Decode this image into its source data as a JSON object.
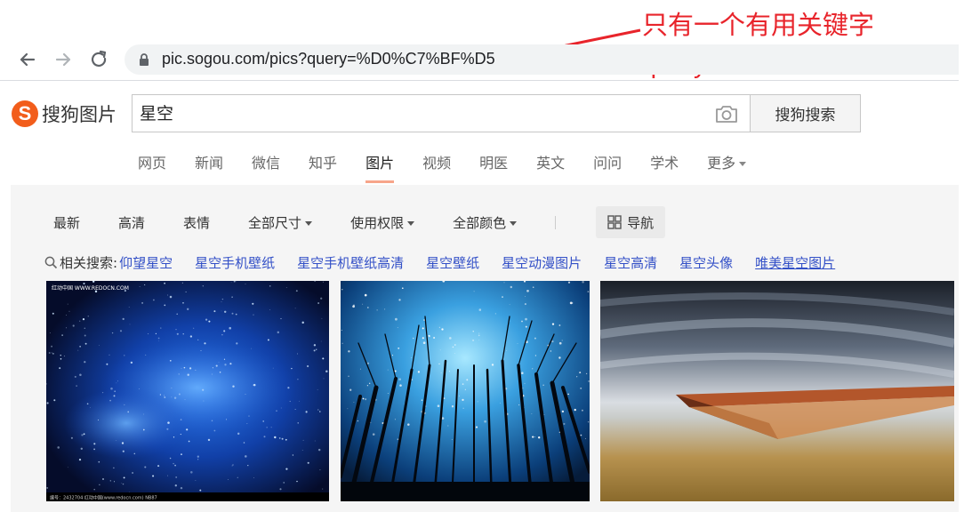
{
  "browser": {
    "url": "pic.sogou.com/pics?query=%D0%C7%BF%D5"
  },
  "annotation": {
    "line1": "只有一个有用关键字",
    "line2": "query",
    "color": "#e8242b"
  },
  "header": {
    "logo_mark": "S",
    "logo_text": "搜狗图片",
    "search_value": "星空",
    "search_button": "搜狗搜索",
    "brand_color": "#f25d1b"
  },
  "tabs": {
    "items": [
      {
        "label": "网页"
      },
      {
        "label": "新闻"
      },
      {
        "label": "微信"
      },
      {
        "label": "知乎"
      },
      {
        "label": "图片",
        "active": true
      },
      {
        "label": "视频"
      },
      {
        "label": "明医"
      },
      {
        "label": "英文"
      },
      {
        "label": "问问"
      },
      {
        "label": "学术"
      }
    ],
    "more": "更多"
  },
  "filters": {
    "latest": "最新",
    "hd": "高清",
    "emoji": "表情",
    "size": "全部尺寸",
    "rights": "使用权限",
    "color": "全部颜色",
    "guide": "导航"
  },
  "related": {
    "label": "相关搜索:",
    "links": [
      "仰望星空",
      "星空手机壁纸",
      "星空手机壁纸高清",
      "星空壁纸",
      "星空动漫图片",
      "星空高清",
      "星空头像",
      "唯美星空图片"
    ],
    "link_color": "#3350c7"
  },
  "images": {
    "items": [
      {
        "alt": "blue nebula starfield",
        "caption_top": "红动中国 WWW.REDOCN.COM",
        "caption_bottom": "编号：2432704   红动中国(www.redocn.com)   NB87"
      },
      {
        "alt": "forest silhouette under starry sky"
      },
      {
        "alt": "long exposure pier at dusk"
      }
    ]
  }
}
